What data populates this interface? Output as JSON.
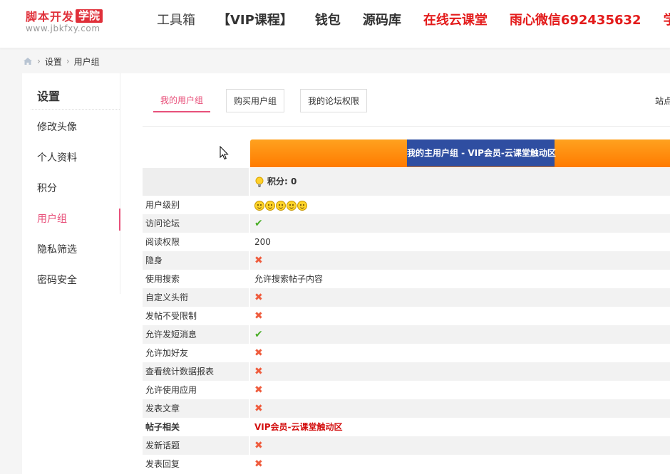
{
  "logo": {
    "text": "脚本开发",
    "badge": "学院",
    "url": "www.jbkfxy.com"
  },
  "nav": [
    {
      "label": "工具箱",
      "style": "plain"
    },
    {
      "label": "【VIP课程】",
      "style": "bold"
    },
    {
      "label": "钱包",
      "style": "bold"
    },
    {
      "label": "源码库",
      "style": "bold"
    },
    {
      "label": "在线云课堂",
      "style": "red"
    },
    {
      "label": "雨心微信692435632",
      "style": "red"
    },
    {
      "label": "学院",
      "style": "red"
    }
  ],
  "breadcrumb": {
    "items": [
      "设置",
      "用户组"
    ]
  },
  "sidebar": {
    "title": "设置",
    "items": [
      {
        "label": "修改头像"
      },
      {
        "label": "个人资料"
      },
      {
        "label": "积分"
      },
      {
        "label": "用户组",
        "active": true
      },
      {
        "label": "隐私筛选"
      },
      {
        "label": "密码安全"
      }
    ]
  },
  "tabs": [
    {
      "label": "我的用户组",
      "active": true
    },
    {
      "label": "购买用户组"
    },
    {
      "label": "我的论坛权限"
    }
  ],
  "site_link": "站点",
  "group": {
    "title": "我的主用户组 - VIP会员-云课堂触动区",
    "points_label": "积分: 0"
  },
  "rows": [
    {
      "label": "用户级别",
      "type": "stars",
      "stars": 5
    },
    {
      "label": "访问论坛",
      "type": "check"
    },
    {
      "label": "阅读权限",
      "type": "text",
      "value": "200"
    },
    {
      "label": "隐身",
      "type": "cross"
    },
    {
      "label": "使用搜索",
      "type": "text",
      "value": "允许搜索帖子内容"
    },
    {
      "label": "自定义头衔",
      "type": "cross"
    },
    {
      "label": "发帖不受限制",
      "type": "cross"
    },
    {
      "label": "允许发短消息",
      "type": "check"
    },
    {
      "label": "允许加好友",
      "type": "cross"
    },
    {
      "label": "查看统计数据报表",
      "type": "cross"
    },
    {
      "label": "允许使用应用",
      "type": "cross"
    },
    {
      "label": "发表文章",
      "type": "cross"
    },
    {
      "label": "帖子相关",
      "type": "section",
      "value": "VIP会员-云课堂触动区"
    },
    {
      "label": "发新话题",
      "type": "cross"
    },
    {
      "label": "发表回复",
      "type": "cross"
    }
  ],
  "colors": {
    "accent": "#e8507a",
    "brand_red": "#e0303a",
    "nav_red": "#e31b1b",
    "header_orange": "#ff8a00",
    "title_blue": "#2f4ea1"
  },
  "icons": {
    "check": "check-icon",
    "cross": "cross-icon",
    "points": "lightbulb-icon",
    "level": "smiley-icon",
    "home": "home-icon"
  }
}
